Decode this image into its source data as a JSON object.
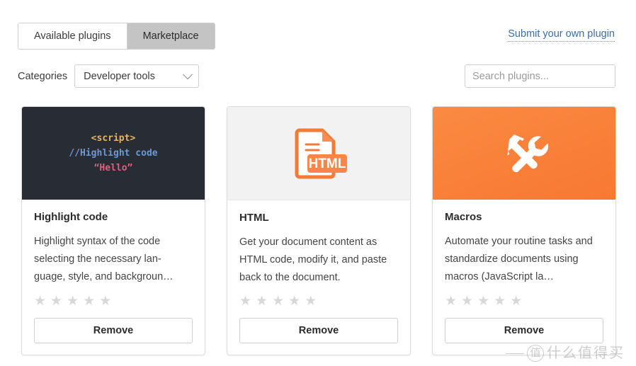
{
  "tabs": [
    {
      "label": "Available plugins",
      "active": false
    },
    {
      "label": "Marketplace",
      "active": true
    }
  ],
  "submit_link": {
    "label": "Submit your own plugin"
  },
  "filters": {
    "categories_label": "Categories",
    "category_selected": "Developer tools",
    "chevron_icon": "chevron-down-icon",
    "search_placeholder": "Search plugins...",
    "search_value": ""
  },
  "colors": {
    "tab_active_bg": "#c4c4c4",
    "link": "#3a6ea5",
    "thumb_dark": "#282c34",
    "thumb_light": "#f2f2f2",
    "thumb_orange": "#f9833f",
    "code_tag": "#e5b567",
    "code_comment": "#6c99d2",
    "code_string": "#e2607c",
    "star_empty": "#d8d8d8"
  },
  "cards": [
    {
      "thumb_kind": "code",
      "thumb_icon": "code-snippet-icon",
      "code_lines": [
        "<script>",
        "//Highlight code",
        "“Hello”"
      ],
      "title": "Highlight code",
      "description": "Highlight syntax of the code selecting the necessary lan-guage, style, and backgroun…",
      "rating": 0,
      "stars_total": 5,
      "button_label": "Remove"
    },
    {
      "thumb_kind": "html",
      "thumb_icon": "html-document-icon",
      "badge_text": "HTML",
      "title": "HTML",
      "description": "Get your document content as HTML code, modify it, and paste back to the document.",
      "rating": 0,
      "stars_total": 5,
      "button_label": "Remove"
    },
    {
      "thumb_kind": "macros",
      "thumb_icon": "hammer-wrench-icon",
      "title": "Macros",
      "description": "Automate your routine tasks and standardize documents using macros (JavaScript la…",
      "rating": 0,
      "stars_total": 5,
      "button_label": "Remove"
    }
  ],
  "watermark": {
    "mark": "值",
    "text": "什么值得买"
  }
}
